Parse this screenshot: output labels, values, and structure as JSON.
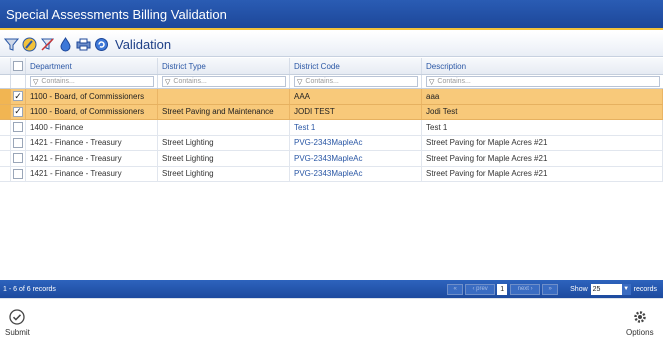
{
  "window": {
    "title": "Special Assessments Billing Validation"
  },
  "toolbar": {
    "title": "Validation",
    "icons": [
      "clear-filter-icon",
      "edit-icon",
      "no-filter-icon",
      "drop-icon",
      "print-icon",
      "refresh-icon"
    ]
  },
  "grid": {
    "columns": [
      {
        "label": "Department"
      },
      {
        "label": "District Type"
      },
      {
        "label": "District Code"
      },
      {
        "label": "Description"
      }
    ],
    "filter_placeholder": "Contains...",
    "rows": [
      {
        "selected": true,
        "checked": true,
        "department": "1100 - Board, of Commissioners",
        "district_type": "",
        "district_code": "AAA",
        "description": "aaa"
      },
      {
        "selected": true,
        "checked": true,
        "department": "1100 - Board, of Commissioners",
        "district_type": "Street Paving and Maintenance",
        "district_code": "JODI TEST",
        "description": "Jodi Test"
      },
      {
        "selected": false,
        "checked": false,
        "department": "1400 - Finance",
        "district_type": "",
        "district_code": "Test 1",
        "description": "Test 1"
      },
      {
        "selected": false,
        "checked": false,
        "department": "1421 - Finance - Treasury",
        "district_type": "Street Lighting",
        "district_code": "PVG-2343MapleAc",
        "description": "Street Paving for Maple Acres #21"
      },
      {
        "selected": false,
        "checked": false,
        "department": "1421 - Finance - Treasury",
        "district_type": "Street Lighting",
        "district_code": "PVG-2343MapleAc",
        "description": "Street Paving for Maple Acres #21"
      },
      {
        "selected": false,
        "checked": false,
        "department": "1421 - Finance - Treasury",
        "district_type": "Street Lighting",
        "district_code": "PVG-2343MapleAc",
        "description": "Street Paving for Maple Acres #21"
      }
    ]
  },
  "pager": {
    "count_text": "1 - 6 of 6 records",
    "prev_label": "‹ prev",
    "next_label": "next ›",
    "first_label": "«",
    "last_label": "»",
    "current_page": "1",
    "show_label": "Show",
    "page_size": "25",
    "records_label": "records"
  },
  "actions": {
    "submit_label": "Submit",
    "options_label": "Options"
  },
  "colors": {
    "title_bg": "#1d4799",
    "accent": "#f2c23a",
    "selected_row": "#f8c97a",
    "link": "#2a57a5"
  }
}
